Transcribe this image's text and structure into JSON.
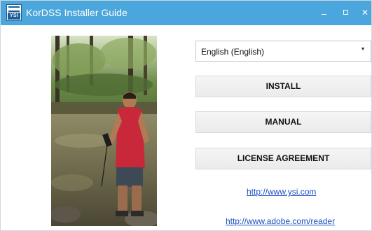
{
  "window": {
    "title": "KorDSS Installer Guide",
    "logo_text": "YSI",
    "controls": {
      "minimize_icon": "minimize-icon",
      "maximize_icon": "maximize-icon",
      "close_symbol": "✕"
    }
  },
  "photo": {
    "subject": "person in red shirt holding a handheld meter by a stream"
  },
  "language": {
    "selected": "English (English)"
  },
  "buttons": {
    "install": "INSTALL",
    "manual": "MANUAL",
    "license": "LICENSE AGREEMENT"
  },
  "links": {
    "ysi": "http://www.ysi.com",
    "adobe": "http://www.adobe.com/reader"
  },
  "colors": {
    "titlebar": "#4aa6dc",
    "link": "#1a4fc4"
  }
}
